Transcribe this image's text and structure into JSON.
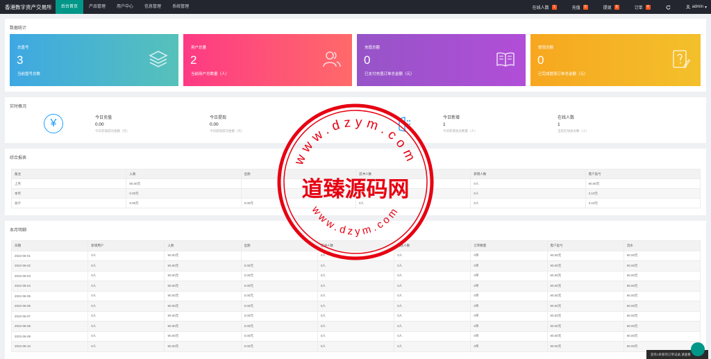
{
  "header": {
    "brand": "香港数字资产交易所",
    "nav": [
      {
        "label": "后台首页",
        "active": true
      },
      {
        "label": "产品管理",
        "active": false
      },
      {
        "label": "用户中心",
        "active": false
      },
      {
        "label": "信息管理",
        "active": false
      },
      {
        "label": "系统管理",
        "active": false
      }
    ],
    "right": [
      {
        "label": "在线人数",
        "badge": "1"
      },
      {
        "label": "充值",
        "badge": "0"
      },
      {
        "label": "提现",
        "badge": "0"
      },
      {
        "label": "订单",
        "badge": "4"
      }
    ],
    "refresh_icon": "refresh-icon",
    "user_icon": "user-icon",
    "user": "admin",
    "user_caret": "▾"
  },
  "stats": {
    "title": "数据统计",
    "cards": [
      {
        "label": "总盘号",
        "value": "3",
        "desc": "当前盘号总数",
        "icon": "stack-icon",
        "gradient": [
          "#3ea8e3",
          "#56c1ba"
        ]
      },
      {
        "label": "用户总量",
        "value": "2",
        "desc": "当前用户总数量（人）",
        "icon": "users-icon",
        "gradient": [
          "#fd3a84",
          "#ff6a6a"
        ]
      },
      {
        "label": "充值总额",
        "value": "0",
        "desc": "已支付充值订单总金额（元）",
        "icon": "book-icon",
        "gradient": [
          "#9654c7",
          "#b14ed8"
        ]
      },
      {
        "label": "提现总额",
        "value": "0",
        "desc": "已完成提现订单总金额（元）",
        "icon": "question-icon",
        "gradient": [
          "#f7a71f",
          "#f3c02b"
        ]
      }
    ]
  },
  "live": {
    "title": "实时概况",
    "icon": "yen-icon",
    "yen_glyph": "¥",
    "blocks": [
      {
        "name": "今日充值",
        "value": "0.00",
        "desc": "今日充值成功金额（元）"
      },
      {
        "name": "今日提现",
        "value": "0.00",
        "desc": "今日提现成功金额（元）"
      },
      {
        "name": "今日新增",
        "value": "1",
        "desc": "今日新增会员数量（人）"
      },
      {
        "name": "在线人数",
        "value": "1",
        "desc": "当前在线会员数（人）"
      }
    ]
  },
  "report": {
    "title": "综合报表",
    "columns": [
      "备注",
      "入款",
      "出款",
      "首冲人数",
      "新增人数",
      "客户盈亏"
    ],
    "rows": [
      [
        "上月",
        "¥0.00元",
        "",
        "",
        "0人",
        "¥0.00元"
      ],
      [
        "本月",
        "0.00元",
        "",
        "",
        "0人",
        "3.10元"
      ],
      [
        "总计",
        "0.00元",
        "0.00元",
        "0人",
        "0人",
        "3.10元"
      ]
    ]
  },
  "detail": {
    "title": "本月明细",
    "columns": [
      "日期",
      "新增用户",
      "入款",
      "出款",
      "首冲人数",
      "活跃人数",
      "订单数量",
      "客户盈亏",
      "流水"
    ],
    "rows": [
      [
        "2022-06-01",
        "0人",
        "¥0.00元",
        "",
        "0人",
        "0人",
        "0单",
        "¥0.00元",
        "¥0.00元"
      ],
      [
        "2022-06-02",
        "0人",
        "¥0.00元",
        "0.00元",
        "0人",
        "0人",
        "0单",
        "¥0.00元",
        "¥0.00元"
      ],
      [
        "2022-06-03",
        "0人",
        "¥0.00元",
        "0.00元",
        "0人",
        "0人",
        "0单",
        "¥0.00元",
        "¥0.00元"
      ],
      [
        "2022-06-04",
        "0人",
        "¥0.00元",
        "0.00元",
        "0人",
        "0人",
        "0单",
        "¥0.00元",
        "¥0.00元"
      ],
      [
        "2022-06-05",
        "0人",
        "¥0.00元",
        "0.00元",
        "0人",
        "0人",
        "0单",
        "¥0.00元",
        "¥0.00元"
      ],
      [
        "2022-06-06",
        "0人",
        "¥0.00元",
        "0.00元",
        "0人",
        "0人",
        "0单",
        "¥0.00元",
        "¥0.00元"
      ],
      [
        "2022-06-07",
        "0人",
        "¥0.00元",
        "0.00元",
        "0人",
        "0人",
        "0单",
        "¥0.00元",
        "¥0.00元"
      ],
      [
        "2022-06-08",
        "0人",
        "¥0.00元",
        "0.00元",
        "0人",
        "0人",
        "0单",
        "¥0.00元",
        "¥0.00元"
      ],
      [
        "2022-06-09",
        "0人",
        "¥0.00元",
        "0.00元",
        "0人",
        "0人",
        "0单",
        "¥0.00元",
        "¥0.00元"
      ],
      [
        "2022-06-10",
        "0人",
        "¥0.00元",
        "0.00元",
        "0人",
        "0人",
        "0单",
        "¥0.00元",
        "¥0.00元"
      ]
    ]
  },
  "watermark": {
    "text": "道臻源码网",
    "url": "www.dzym.com",
    "color": "#e60012"
  },
  "toast": "您有1条新的订单记录,请查看"
}
